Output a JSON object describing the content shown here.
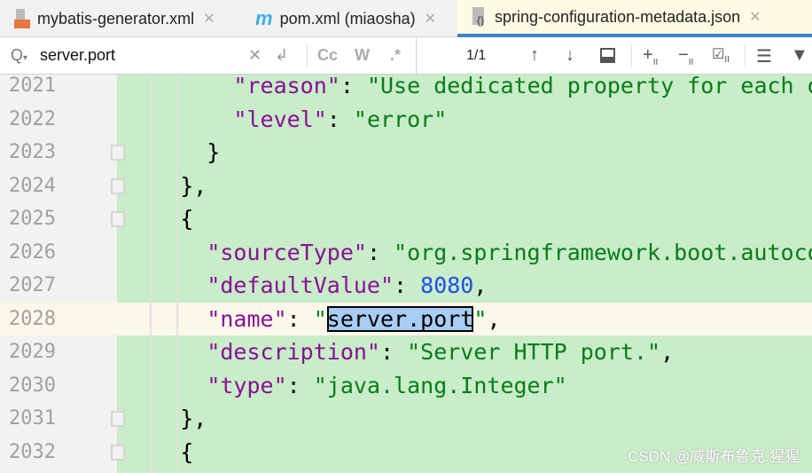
{
  "tabs": [
    {
      "label": "mybatis-generator.xml",
      "icon": "xml-file-icon",
      "active": false
    },
    {
      "label": "pom.xml (miaosha)",
      "icon": "maven-icon",
      "active": false
    },
    {
      "label": "spring-configuration-metadata.json",
      "icon": "json-file-icon",
      "active": true
    }
  ],
  "search": {
    "value": "server.port",
    "match_count": "1/1",
    "case_label": "Cc",
    "words_label": "W",
    "regex_label": ".*"
  },
  "lines": [
    {
      "num": "2021",
      "html": "        <span class=\"k\">\"reason\"</span>: <span class=\"s\">\"Use dedicated property for each o</span>"
    },
    {
      "num": "2022",
      "html": "        <span class=\"k\">\"level\"</span>: <span class=\"s\">\"error\"</span>"
    },
    {
      "num": "2023",
      "html": "      }"
    },
    {
      "num": "2024",
      "html": "    },"
    },
    {
      "num": "2025",
      "html": "    {"
    },
    {
      "num": "2026",
      "html": "      <span class=\"k\">\"sourceType\"</span>: <span class=\"s\">\"org.springframework.boot.autoco</span>"
    },
    {
      "num": "2027",
      "html": "      <span class=\"k\">\"defaultValue\"</span>: <span class=\"n\">8080</span>,"
    },
    {
      "num": "2028",
      "html": "      <span class=\"k\">\"name\"</span>: <span class=\"s\">\"</span><span class=\"hl\">server.port</span><span class=\"s\">\"</span>,"
    },
    {
      "num": "2029",
      "html": "      <span class=\"k\">\"description\"</span>: <span class=\"s\">\"Server HTTP port.\"</span>,"
    },
    {
      "num": "2030",
      "html": "      <span class=\"k\">\"type\"</span>: <span class=\"s\">\"java.lang.Integer\"</span>"
    },
    {
      "num": "2031",
      "html": "    },"
    },
    {
      "num": "2032",
      "html": "    {"
    }
  ],
  "watermark": "CSDN @威斯布鲁克.猩猩"
}
